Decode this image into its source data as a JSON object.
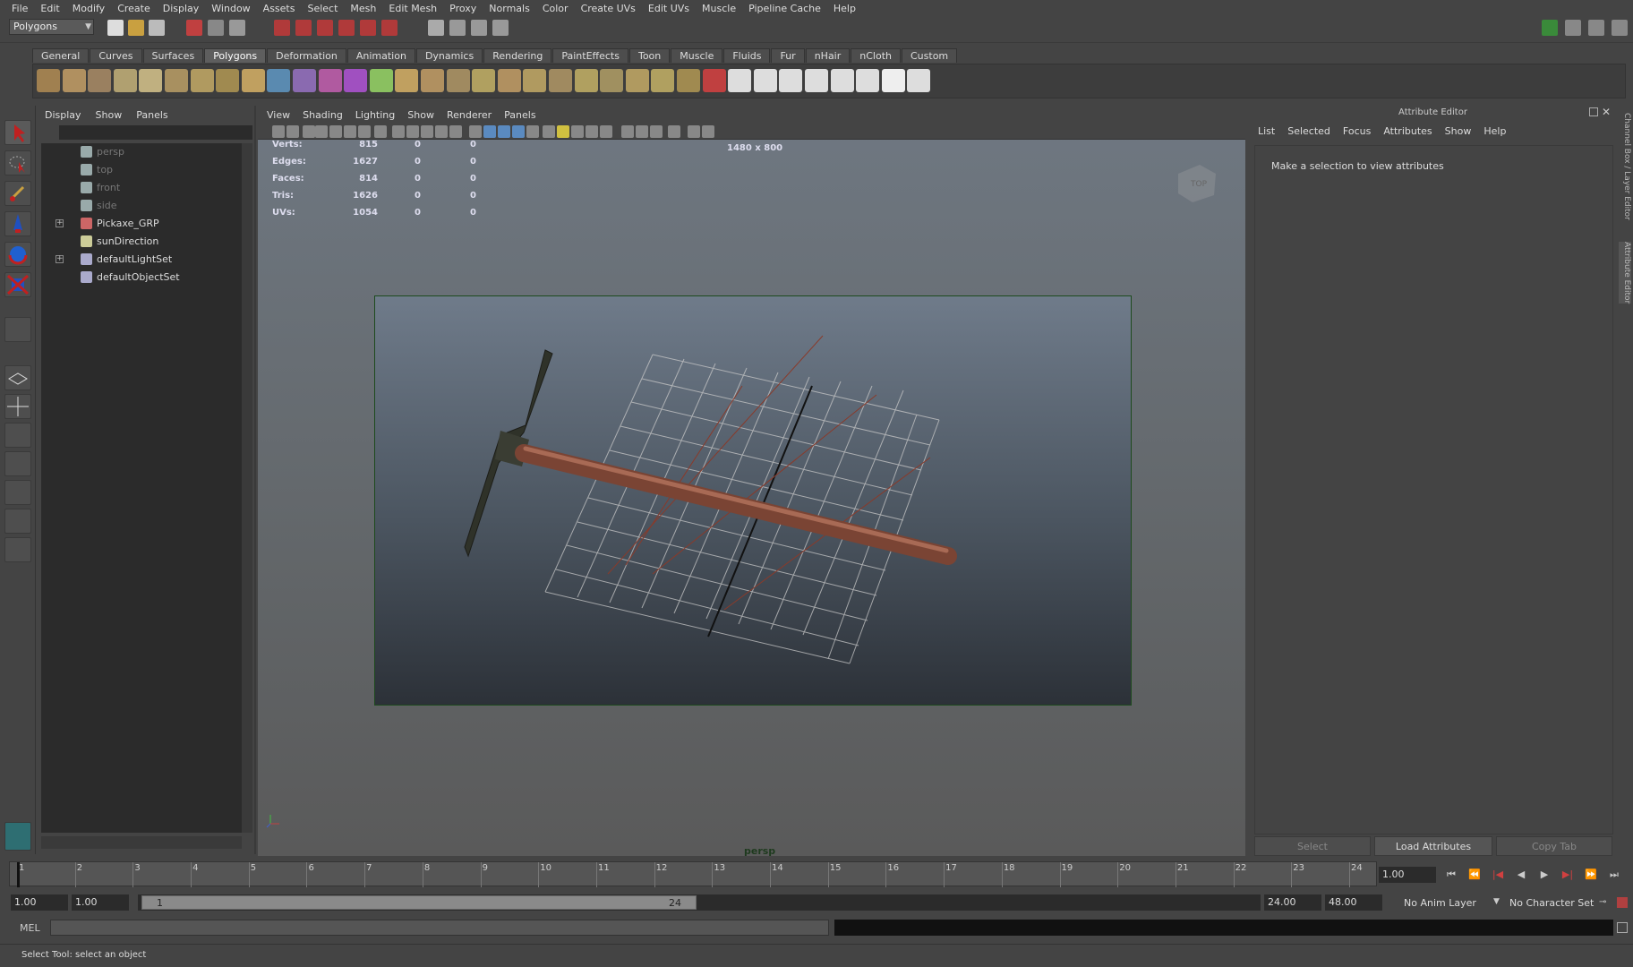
{
  "menubar": [
    "File",
    "Edit",
    "Modify",
    "Create",
    "Display",
    "Window",
    "Assets",
    "Select",
    "Mesh",
    "Edit Mesh",
    "Proxy",
    "Normals",
    "Color",
    "Create UVs",
    "Edit UVs",
    "Muscle",
    "Pipeline Cache",
    "Help"
  ],
  "status": {
    "mode": "Polygons"
  },
  "shelf": {
    "tabs": [
      "General",
      "Curves",
      "Surfaces",
      "Polygons",
      "Deformation",
      "Animation",
      "Dynamics",
      "Rendering",
      "PaintEffects",
      "Toon",
      "Muscle",
      "Fluids",
      "Fur",
      "nHair",
      "nCloth",
      "Custom"
    ],
    "active_tab": "Polygons"
  },
  "outliner": {
    "menu": [
      "Display",
      "Show",
      "Panels"
    ],
    "items": [
      {
        "label": "persp",
        "dim": true,
        "expand": false,
        "icon": "camera-icon"
      },
      {
        "label": "top",
        "dim": true,
        "expand": false,
        "icon": "camera-icon"
      },
      {
        "label": "front",
        "dim": true,
        "expand": false,
        "icon": "camera-icon"
      },
      {
        "label": "side",
        "dim": true,
        "expand": false,
        "icon": "camera-icon"
      },
      {
        "label": "Pickaxe_GRP",
        "dim": false,
        "expand": true,
        "icon": "group-icon"
      },
      {
        "label": "sunDirection",
        "dim": false,
        "expand": false,
        "icon": "light-icon"
      },
      {
        "label": "defaultLightSet",
        "dim": false,
        "expand": true,
        "icon": "set-icon"
      },
      {
        "label": "defaultObjectSet",
        "dim": false,
        "expand": false,
        "icon": "set-icon"
      }
    ]
  },
  "viewport": {
    "menu": [
      "View",
      "Shading",
      "Lighting",
      "Show",
      "Renderer",
      "Panels"
    ],
    "hud": [
      {
        "label": "Verts:",
        "v1": "815",
        "v2": "0",
        "v3": "0"
      },
      {
        "label": "Edges:",
        "v1": "1627",
        "v2": "0",
        "v3": "0"
      },
      {
        "label": "Faces:",
        "v1": "814",
        "v2": "0",
        "v3": "0"
      },
      {
        "label": "Tris:",
        "v1": "1626",
        "v2": "0",
        "v3": "0"
      },
      {
        "label": "UVs:",
        "v1": "1054",
        "v2": "0",
        "v3": "0"
      }
    ],
    "resolution": "1480 x 800",
    "camera": "persp",
    "viewcube_label": "TOP"
  },
  "attribute_editor": {
    "title": "Attribute Editor",
    "menu": [
      "List",
      "Selected",
      "Focus",
      "Attributes",
      "Show",
      "Help"
    ],
    "message": "Make a selection to view attributes",
    "buttons": {
      "select": "Select",
      "load": "Load Attributes",
      "copy": "Copy Tab"
    },
    "side_tabs": [
      "Channel Box / Layer Editor",
      "Attribute Editor"
    ]
  },
  "timeline": {
    "frames": [
      "1",
      "2",
      "3",
      "4",
      "5",
      "6",
      "7",
      "8",
      "9",
      "10",
      "11",
      "12",
      "13",
      "14",
      "15",
      "16",
      "17",
      "18",
      "19",
      "20",
      "21",
      "22",
      "23",
      "24"
    ],
    "current": "1.00"
  },
  "range": {
    "start": "1.00",
    "playback_start": "1.00",
    "slider_start": "1",
    "slider_end": "24",
    "playback_end": "24.00",
    "end": "48.00",
    "anim_layer": "No Anim Layer",
    "character_set": "No Character Set"
  },
  "cmd": {
    "label": "MEL"
  },
  "help": {
    "text": "Select Tool: select an object"
  },
  "colors": {
    "accent_green": "#2e6b2e",
    "handle_wood": "#8a4e3a",
    "pick_metal": "#3a3d33"
  }
}
